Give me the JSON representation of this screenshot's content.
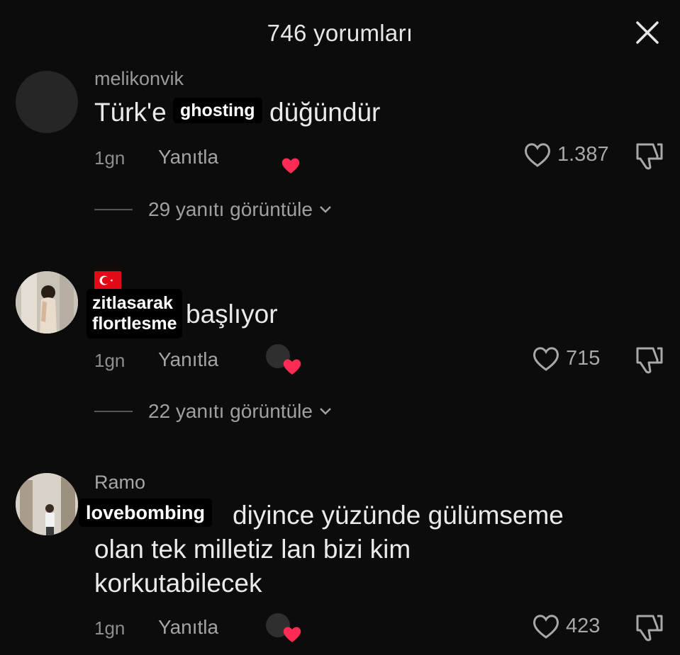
{
  "header": {
    "title": "746 yorumları",
    "close_icon": "close-icon"
  },
  "comments": [
    {
      "username": "melikonvik",
      "text_before": "Türk'e",
      "sticker": "ghosting",
      "text_after": "düğündür",
      "time": "1gn",
      "reply_label": "Yanıtla",
      "likes": "1.387",
      "replies": "29 yanıtı görüntüle"
    },
    {
      "username_flag": "turkey-flag-icon",
      "sticker": "zitlasarak\nflortlesme",
      "text_after": "başlıyor",
      "time": "1gn",
      "reply_label": "Yanıtla",
      "likes": "715",
      "replies": "22 yanıtı görüntüle"
    },
    {
      "username": "Ramo",
      "sticker": "lovebombing",
      "text_line1": "diyince yüzünde gülümseme",
      "text_line2": "olan tek milletiz lan bizi kim",
      "text_line3": "korkutabilecek",
      "time": "1gn",
      "reply_label": "Yanıtla",
      "likes": "423"
    }
  ],
  "colors": {
    "background": "#0c0c0c",
    "heart": "#fe2c55",
    "text": "#eaeaea",
    "muted": "#8e8e8e"
  }
}
